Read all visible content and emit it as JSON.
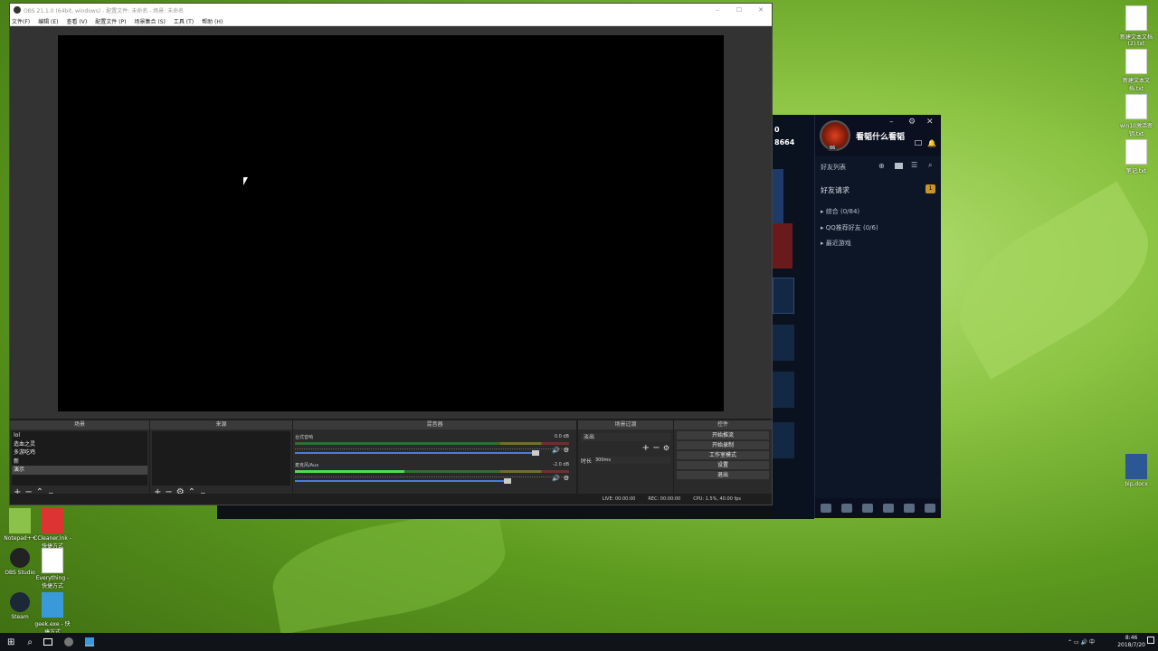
{
  "obs": {
    "title": "OBS 21.1.0 (64bit, windows) - 配置文件: 未命名 - 场景: 未命名",
    "menu": [
      "文件(F)",
      "编辑 (E)",
      "查看 (V)",
      "配置文件 (P)",
      "场景集合 (S)",
      "工具 (T)",
      "帮助 (H)"
    ],
    "docks": {
      "scenes": {
        "title": "场景",
        "items": [
          "lol",
          "造血之灵",
          "多游吃鸡",
          "新",
          "演示"
        ],
        "selected": 4
      },
      "sources": {
        "title": "来源"
      },
      "mixer": {
        "title": "混音器",
        "channels": [
          {
            "name": "台式音响",
            "db": "0.0 dB",
            "level": 0.0,
            "volume": 0.92
          },
          {
            "name": "麦克风/Aux",
            "db": "-2.0 dB",
            "level": 0.4,
            "volume": 0.82
          }
        ]
      },
      "transitions": {
        "title": "场景过渡",
        "type": "淡出",
        "duration_label": "时长",
        "duration": "300ms"
      },
      "controls": {
        "title": "控件",
        "buttons": [
          "开始推流",
          "开始录制",
          "工作室模式",
          "设置",
          "退出"
        ]
      }
    },
    "status": {
      "live": "LIVE: 00:00:00",
      "rec": "REC: 00:00:00",
      "cpu": "CPU: 1.5%, 40.00 fps"
    }
  },
  "qq": {
    "name": "看韬什么看韬",
    "level": "66",
    "friend_list": "好友列表",
    "friend_request": "好友请求",
    "request_count": "1",
    "groups": [
      "综合 (0/84)",
      "QQ推荐好友 (0/6)",
      "最近游戏"
    ]
  },
  "lol_side": {
    "num1": "0",
    "num2": "8664"
  },
  "desktop": {
    "icons_right": [
      "新建文本文档 (2).txt",
      "新建文本文档.txt",
      "win10激活密钥.txt",
      "笔记.txt",
      "bip.docx"
    ],
    "icons_left": [
      "Notepad++",
      "CCleaner.lnk - 快捷方式",
      "OBS Studio",
      "Everything - 快捷方式",
      "Steam",
      "geek.exe - 快捷方式"
    ]
  },
  "taskbar": {
    "time": "8:46",
    "date": "2018/7/20"
  }
}
